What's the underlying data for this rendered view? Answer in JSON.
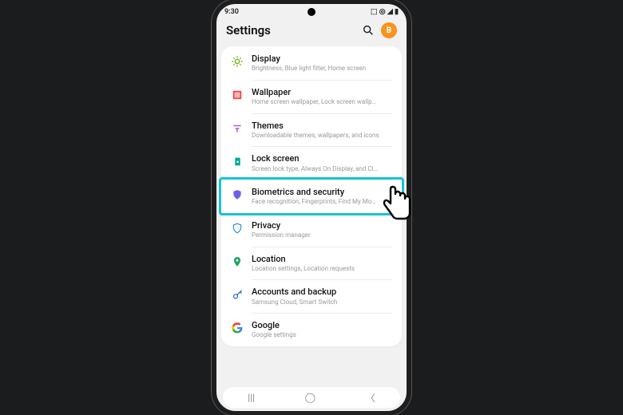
{
  "statusbar": {
    "time": "9:30",
    "right": "⬚ ◎ ◢ ▮"
  },
  "header": {
    "title": "Settings",
    "avatar": "B"
  },
  "items": [
    {
      "icon": "display",
      "title": "Display",
      "sub": "Brightness, Blue light filter, Home screen"
    },
    {
      "icon": "wallpaper",
      "title": "Wallpaper",
      "sub": "Home screen wallpaper, Lock screen wallpaper"
    },
    {
      "icon": "themes",
      "title": "Themes",
      "sub": "Downloadable themes, wallpapers, and icons"
    },
    {
      "icon": "lock",
      "title": "Lock screen",
      "sub": "Screen lock type, Always On Display, and Clock style"
    },
    {
      "icon": "biometrics",
      "title": "Biometrics and security",
      "sub": "Face recognition, Fingerprints, Find My Mobile"
    },
    {
      "icon": "privacy",
      "title": "Privacy",
      "sub": "Permission manager"
    },
    {
      "icon": "location",
      "title": "Location",
      "sub": "Location settings, Location requests"
    },
    {
      "icon": "accounts",
      "title": "Accounts and backup",
      "sub": "Samsung Cloud, Smart Switch"
    },
    {
      "icon": "google",
      "title": "Google",
      "sub": "Google settings"
    }
  ],
  "highlighted_index": 4,
  "nav": {
    "recent": "|||",
    "home": "◯",
    "back": "〈"
  }
}
